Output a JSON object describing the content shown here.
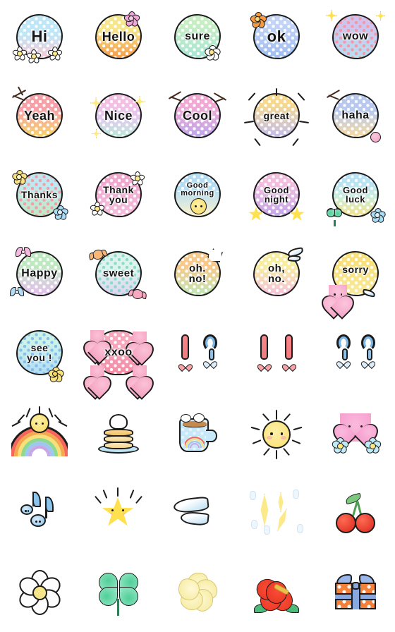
{
  "page": {
    "title": "Emoji sticker sheet",
    "background_color": "#ffffff",
    "grid": {
      "columns": 5,
      "rows": 8,
      "cell_size_px": 112
    }
  },
  "stickers": [
    {
      "id": "hi",
      "label": "Hi",
      "row": 1,
      "col": 1,
      "kind": "text-bubble",
      "bubble_colors": [
        "#bfe7f7",
        "#f9c8d4"
      ],
      "heart_color": "#ffffff",
      "decorations": [
        "daisy-flower",
        "daisy-flower"
      ]
    },
    {
      "id": "hello",
      "label": "Hello",
      "row": 1,
      "col": 2,
      "kind": "text-bubble",
      "bubble_colors": [
        "#f6e07a",
        "#f59c4a"
      ],
      "heart_color": "#ffffff",
      "decorations": [
        "pink-flower"
      ]
    },
    {
      "id": "sure",
      "label": "sure",
      "row": 1,
      "col": 3,
      "kind": "text-bubble",
      "bubble_colors": [
        "#c8eec3",
        "#a8e6d5"
      ],
      "heart_color": "#ffffff",
      "decorations": [
        "plumeria-flower"
      ]
    },
    {
      "id": "ok",
      "label": "ok",
      "row": 1,
      "col": 4,
      "kind": "text-bubble",
      "bubble_colors": [
        "#b9cdf5",
        "#a8c4f2"
      ],
      "heart_color": "#ffffff",
      "decorations": [
        "orange-hibiscus"
      ]
    },
    {
      "id": "wow",
      "label": "wow",
      "row": 1,
      "col": 5,
      "kind": "text-bubble",
      "bubble_colors": [
        "#cfc4ee",
        "#b7dff2"
      ],
      "heart_color": "#f9c2d8",
      "decorations": [
        "sparkle",
        "sparkle"
      ]
    },
    {
      "id": "yeah",
      "label": "Yeah",
      "row": 2,
      "col": 1,
      "kind": "text-bubble",
      "bubble_colors": [
        "#f6a0a8",
        "#f7d46a"
      ],
      "heart_color": "#ffffff",
      "decorations": [
        "scribble-lines"
      ]
    },
    {
      "id": "nice",
      "label": "Nice",
      "row": 2,
      "col": 2,
      "kind": "text-bubble",
      "bubble_colors": [
        "#f3bfe2",
        "#b9ead8"
      ],
      "heart_color": "#ffffff",
      "decorations": [
        "sparkle-star",
        "sparkle-star"
      ]
    },
    {
      "id": "cool",
      "label": "Cool",
      "row": 2,
      "col": 3,
      "kind": "text-bubble",
      "bubble_colors": [
        "#f2a9d3",
        "#bfa8ea"
      ],
      "heart_color": "#ffffff",
      "decorations": [
        "scribble-lines"
      ]
    },
    {
      "id": "great",
      "label": "great",
      "row": 2,
      "col": 4,
      "kind": "text-bubble",
      "bubble_colors": [
        "#f6d98e",
        "#c3bdee"
      ],
      "heart_color": "#ffffff",
      "decorations": [
        "scribble-rays"
      ]
    },
    {
      "id": "haha",
      "label": "haha",
      "row": 2,
      "col": 5,
      "kind": "text-bubble",
      "bubble_colors": [
        "#b9c9ee",
        "#f8dba0"
      ],
      "heart_color": "#ffffff",
      "decorations": [
        "scribble-lines",
        "pink-ball"
      ]
    },
    {
      "id": "thanks",
      "label": "Thanks",
      "row": 3,
      "col": 1,
      "kind": "text-bubble",
      "bubble_colors": [
        "#bfe8f2",
        "#bfe9c6"
      ],
      "heart_color": "#f58b8b",
      "decorations": [
        "yellow-flower",
        "blue-flower"
      ]
    },
    {
      "id": "thank-you",
      "label": "Thank\nyou",
      "row": 3,
      "col": 2,
      "kind": "text-bubble",
      "bubble_colors": [
        "#f0a8cf",
        "#f3c0df"
      ],
      "heart_color": "#ffffff",
      "decorations": [
        "daisy-flower",
        "daisy-flower"
      ]
    },
    {
      "id": "good-morning",
      "label": "Good\nmorning",
      "row": 3,
      "col": 3,
      "kind": "text-bubble",
      "bubble_colors": [
        "#b4ddf4",
        "#fdf3cd"
      ],
      "heart_color": "#ffffff",
      "decorations": [
        "sun-face"
      ]
    },
    {
      "id": "good-night",
      "label": "Good\nnight",
      "row": 3,
      "col": 4,
      "kind": "text-bubble",
      "bubble_colors": [
        "#f3bfe0",
        "#c4a6e8"
      ],
      "heart_color": "#ffffff",
      "decorations": [
        "star",
        "star"
      ]
    },
    {
      "id": "good-luck",
      "label": "Good\nluck",
      "row": 3,
      "col": 5,
      "kind": "text-bubble",
      "bubble_colors": [
        "#b9e2f4",
        "#f6e28c"
      ],
      "heart_color": "#ffffff",
      "decorations": [
        "four-leaf-clover",
        "blue-flower"
      ]
    },
    {
      "id": "happy",
      "label": "Happy",
      "row": 4,
      "col": 1,
      "kind": "text-bubble",
      "bubble_colors": [
        "#bfe9c0",
        "#e6bff0"
      ],
      "heart_color": "#ffffff",
      "decorations": [
        "pink-ribbon",
        "blue-ribbon"
      ]
    },
    {
      "id": "sweet",
      "label": "sweet",
      "row": 4,
      "col": 2,
      "kind": "text-bubble",
      "bubble_colors": [
        "#d9f2ea",
        "#ded4f2"
      ],
      "heart_color": "#b9e8d8",
      "decorations": [
        "orange-candy",
        "pink-candy"
      ]
    },
    {
      "id": "oh-no-excl",
      "label": "oh.\nno!",
      "row": 4,
      "col": 3,
      "kind": "text-bubble",
      "bubble_colors": [
        "#f7c98a",
        "#bfe8b9"
      ],
      "heart_color": "#ffffff",
      "decorations": [
        "white-splash"
      ]
    },
    {
      "id": "oh-no-period",
      "label": "oh,\nno.",
      "row": 4,
      "col": 4,
      "kind": "text-bubble",
      "bubble_colors": [
        "#f7eda0",
        "#f6c2de"
      ],
      "heart_color": "#ffffff",
      "decorations": [
        "blue-wing"
      ]
    },
    {
      "id": "sorry",
      "label": "sorry",
      "row": 4,
      "col": 5,
      "kind": "text-bubble",
      "bubble_colors": [
        "#f8e07a",
        "#f9e896"
      ],
      "heart_color": "#ffffff",
      "decorations": [
        "pink-heart-face",
        "blue-wing"
      ]
    },
    {
      "id": "see-you",
      "label": "see\nyou !",
      "row": 5,
      "col": 1,
      "kind": "text-bubble",
      "bubble_colors": [
        "#c9f0e6",
        "#bde0f5"
      ],
      "heart_color": "#9ecff0",
      "decorations": [
        "yellow-flower"
      ]
    },
    {
      "id": "xxoo",
      "label": "xxoo",
      "row": 5,
      "col": 2,
      "kind": "text-bubble",
      "bubble_colors": [
        "#f7a8bd",
        "#f68ba5"
      ],
      "heart_color": "#ffffff",
      "decorations": [
        "pink-heart",
        "pink-heart",
        "pink-heart",
        "pink-heart"
      ]
    },
    {
      "id": "excl-question",
      "label": "!?",
      "row": 5,
      "col": 3,
      "kind": "punctuation",
      "marks": [
        "exclamation-red",
        "question-blue"
      ]
    },
    {
      "id": "double-excl",
      "label": "!!",
      "row": 5,
      "col": 4,
      "kind": "punctuation",
      "marks": [
        "exclamation-red",
        "exclamation-red"
      ]
    },
    {
      "id": "double-question",
      "label": "??",
      "row": 5,
      "col": 5,
      "kind": "punctuation",
      "marks": [
        "question-blue",
        "question-blue"
      ]
    },
    {
      "id": "rainbow",
      "label": "",
      "row": 6,
      "col": 1,
      "kind": "picture",
      "icon": "rainbow-with-sun"
    },
    {
      "id": "pancakes",
      "label": "",
      "row": 6,
      "col": 2,
      "kind": "picture",
      "icon": "pancakes-with-cream"
    },
    {
      "id": "hot-drink",
      "label": "",
      "row": 6,
      "col": 3,
      "kind": "picture",
      "icon": "rainbow-mug"
    },
    {
      "id": "sun",
      "label": "",
      "row": 6,
      "col": 4,
      "kind": "picture",
      "icon": "smiling-sun"
    },
    {
      "id": "heart-flowers",
      "label": "",
      "row": 6,
      "col": 5,
      "kind": "picture",
      "icon": "pink-heart-with-flowers"
    },
    {
      "id": "music-notes",
      "label": "",
      "row": 7,
      "col": 1,
      "kind": "picture",
      "icon": "blue-music-notes"
    },
    {
      "id": "star",
      "label": "",
      "row": 7,
      "col": 2,
      "kind": "picture",
      "icon": "shining-star-face"
    },
    {
      "id": "wings",
      "label": "",
      "row": 7,
      "col": 3,
      "kind": "picture",
      "icon": "white-wings"
    },
    {
      "id": "sparkles",
      "label": "",
      "row": 7,
      "col": 4,
      "kind": "picture",
      "icon": "yellow-sparkles"
    },
    {
      "id": "cherries",
      "label": "",
      "row": 7,
      "col": 5,
      "kind": "picture",
      "icon": "red-cherries"
    },
    {
      "id": "daisy",
      "label": "",
      "row": 8,
      "col": 1,
      "kind": "picture",
      "icon": "white-daisy"
    },
    {
      "id": "clover",
      "label": "",
      "row": 8,
      "col": 2,
      "kind": "picture",
      "icon": "four-leaf-clover"
    },
    {
      "id": "plumeria",
      "label": "",
      "row": 8,
      "col": 3,
      "kind": "picture",
      "icon": "yellow-plumeria"
    },
    {
      "id": "hibiscus",
      "label": "",
      "row": 8,
      "col": 4,
      "kind": "picture",
      "icon": "red-hibiscus"
    },
    {
      "id": "gift",
      "label": "",
      "row": 8,
      "col": 5,
      "kind": "picture",
      "icon": "orange-gift-box"
    }
  ],
  "palette": {
    "outline": "#1a1a1a",
    "pink": "#f69ebc",
    "blue": "#8cc4ec",
    "yellow": "#fbdf6e",
    "green": "#7cc87e",
    "red": "#e5351f",
    "orange": "#f4813a",
    "purple": "#c4a6e8"
  }
}
